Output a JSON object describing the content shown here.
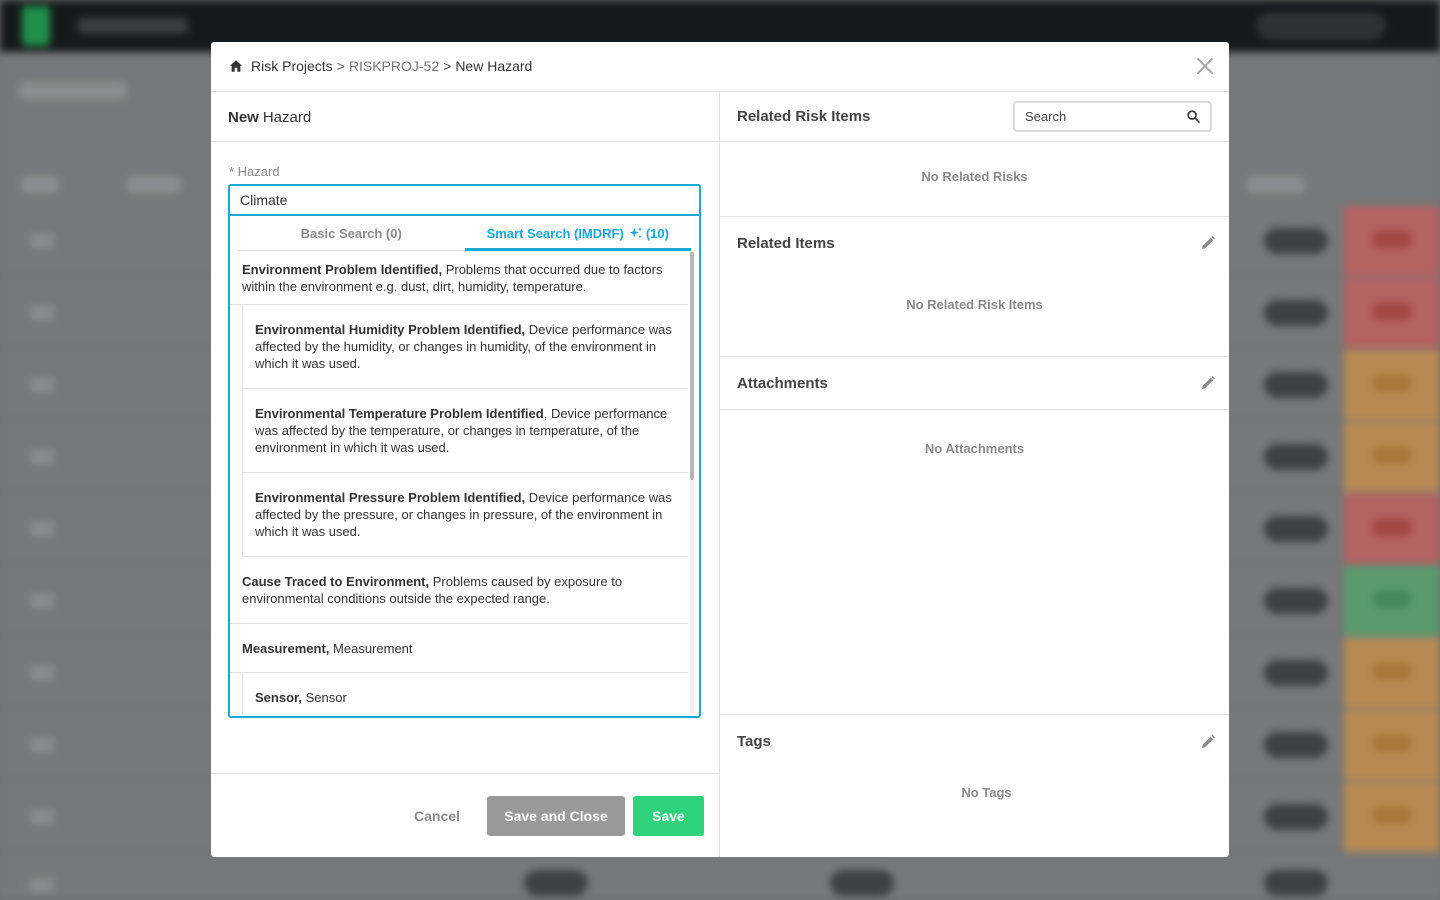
{
  "breadcrumb": {
    "home": "Risk Projects",
    "sep1": ">",
    "project": "RISKPROJ-52",
    "sep2": ">",
    "current": "New Hazard"
  },
  "form": {
    "title_bold": "New",
    "title_rest": "Hazard",
    "field_label": "* Hazard",
    "hazard_value": "Climate",
    "tabs": {
      "basic": "Basic Search (0)",
      "smart": "Smart Search (IMDRF)",
      "smart_count": "(10)"
    },
    "results": [
      {
        "term": "Environment Problem Identified,",
        "desc": " Problems that occurred due to factors within the environment e.g. dust, dirt, humidity, temperature."
      },
      {
        "term": "Environmental Humidity Problem Identified,",
        "desc": " Device performance was affected by the humidity, or changes in humidity, of the environment in which it was used."
      },
      {
        "term": "Environmental Temperature Problem Identified",
        "desc": ", Device performance was affected by the temperature, or changes in temperature, of the environment in which it was used."
      },
      {
        "term": "Environmental Pressure Problem Identified,",
        "desc": " Device performance was affected by the pressure, or changes in pressure, of the environment in which it was used."
      },
      {
        "term": "Cause Traced to Environment,",
        "desc": " Problems caused by exposure to environmental conditions outside the expected range."
      },
      {
        "term": "Measurement,",
        "desc": " Measurement"
      },
      {
        "term": "Sensor,",
        "desc": " Sensor"
      }
    ],
    "buttons": {
      "cancel": "Cancel",
      "save_close": "Save and Close",
      "save": "Save"
    }
  },
  "right": {
    "related_risk_items": {
      "title": "Related Risk Items",
      "search_placeholder": "Search",
      "empty": "No Related Risks"
    },
    "related_items": {
      "title": "Related Items",
      "empty": "No Related Risk Items"
    },
    "attachments": {
      "title": "Attachments",
      "empty": "No Attachments"
    },
    "tags": {
      "title": "Tags",
      "empty": "No Tags"
    }
  },
  "colors": {
    "accent": "#1aa8d9",
    "save": "#2ed27d",
    "save_close": "#9a9a9a"
  }
}
